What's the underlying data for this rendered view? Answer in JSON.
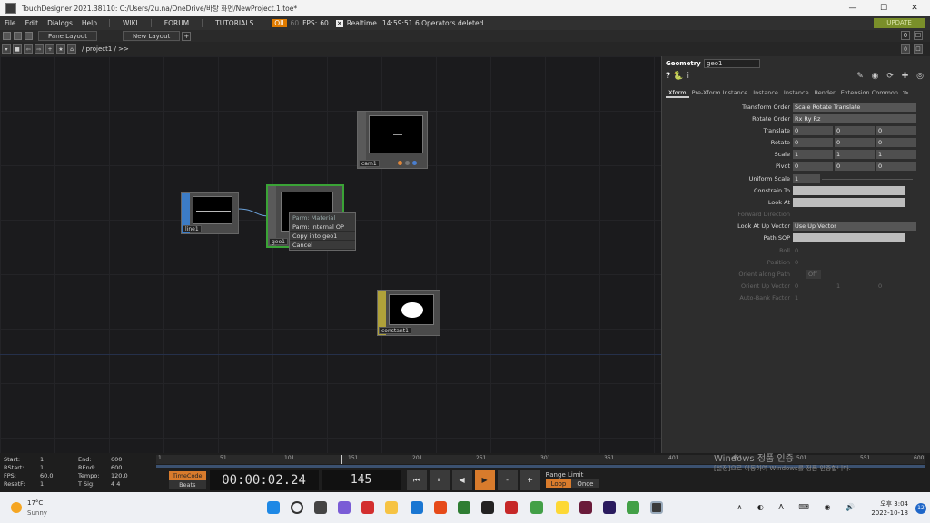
{
  "window": {
    "title": "TouchDesigner 2021.38110: C:/Users/2u.na/OneDrive/바탕 화면/NewProject.1.toe*",
    "controls": [
      "—",
      "☐",
      "✕"
    ]
  },
  "menubar": {
    "items": [
      "File",
      "Edit",
      "Dialogs",
      "Help"
    ],
    "links": [
      "WIKI",
      "FORUM",
      "TUTORIALS"
    ],
    "oi": "OII",
    "fps_target": "60",
    "fps_label": "FPS:",
    "fps_value": "60",
    "realtime_check": "✕",
    "realtime_label": "Realtime",
    "status": "14:59:51 6 Operators deleted.",
    "update": "UPDATE"
  },
  "panebar": {
    "pane_layout": "Pane Layout",
    "new_layout": "New Layout",
    "plus": "+",
    "right_buttons": [
      "0",
      "☐"
    ]
  },
  "pathbar": {
    "path": "/ project1 / >>"
  },
  "nodes": {
    "cam1": "cam1",
    "line1": "line1",
    "geo1": "geo1",
    "constant1": "constant1"
  },
  "context_menu": [
    "Parm: Material",
    "Parm: Internal OP",
    "Copy into geo1",
    "Cancel"
  ],
  "params": {
    "header": "Geometry",
    "opname": "geo1",
    "help": "? 🐍 i",
    "tabs": [
      "Xform",
      "Pre-Xform",
      "Instance",
      "Instance",
      "Instance",
      "Render",
      "Extensions",
      "Common"
    ],
    "tabs_more": "≫",
    "rows": [
      {
        "label": "Transform Order",
        "value": "Scale Rotate Translate"
      },
      {
        "label": "Rotate Order",
        "value": "Rx Ry Rz"
      },
      {
        "label": "Translate",
        "v1": "0",
        "v2": "0",
        "v3": "0"
      },
      {
        "label": "Rotate",
        "v1": "0",
        "v2": "0",
        "v3": "0"
      },
      {
        "label": "Scale",
        "v1": "1",
        "v2": "1",
        "v3": "1"
      },
      {
        "label": "Pivot",
        "v1": "0",
        "v2": "0",
        "v3": "0"
      },
      {
        "label": "Uniform Scale",
        "value": "1"
      },
      {
        "label": "Constrain To",
        "value": ""
      },
      {
        "label": "Look At",
        "value": ""
      },
      {
        "label": "Forward Direction",
        "value": ""
      },
      {
        "label": "Look At Up Vector",
        "value": "Use Up Vector"
      },
      {
        "label": "Path SOP",
        "value": ""
      },
      {
        "label": "Roll",
        "value": "0"
      },
      {
        "label": "Position",
        "value": "0"
      },
      {
        "label": "Orient along Path",
        "value": "Off"
      },
      {
        "label": "Orient Up Vector",
        "v1": "0",
        "v2": "1",
        "v3": "0"
      },
      {
        "label": "Auto-Bank Factor",
        "value": "1"
      }
    ]
  },
  "timeline": {
    "info": [
      {
        "k": "Start:",
        "v": "1",
        "k2": "End:",
        "v2": "600"
      },
      {
        "k": "RStart:",
        "v": "1",
        "k2": "REnd:",
        "v2": "600"
      },
      {
        "k": "FPS:",
        "v": "60.0",
        "k2": "Tempo:",
        "v2": "120.0"
      },
      {
        "k": "ResetF:",
        "v": "1",
        "k2": "T Sig:",
        "v2": "4   4"
      }
    ],
    "ticks": [
      "1",
      "51",
      "101",
      "151",
      "201",
      "251",
      "301",
      "351",
      "401",
      "451",
      "501",
      "551",
      "600"
    ],
    "timecode_label": "TimeCode",
    "beats_label": "Beats",
    "timecode": "00:00:02.24",
    "frame": "145",
    "buttons": [
      "⏮",
      "⏸",
      "◀",
      "▶",
      "-",
      "+"
    ],
    "range_label": "Range Limit",
    "loop": "Loop",
    "once": "Once"
  },
  "watermark": {
    "line1": "Windows 정품 인증",
    "line2": "[설정]으로 이동하여 Windows를 정품 인증합니다."
  },
  "taskbar": {
    "temp": "17°C",
    "weather": "Sunny",
    "time": "오후 3:04",
    "date": "2022-10-18",
    "notifications": "12",
    "sys": "∧ ◐ A ⌨ ◉ 🔊"
  }
}
